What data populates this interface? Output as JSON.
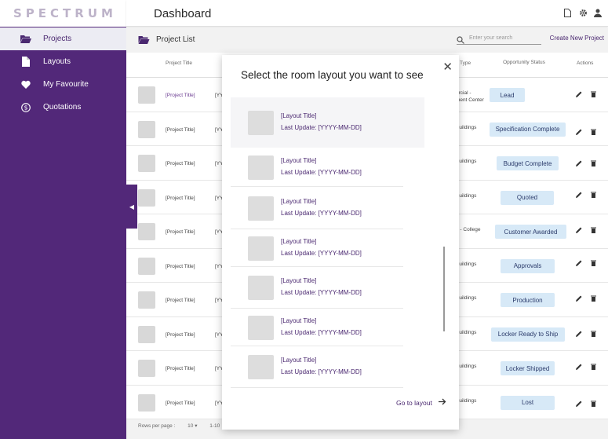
{
  "app": {
    "logo": "SPECTRUM",
    "page_title": "Dashboard"
  },
  "sidebar": {
    "items": [
      {
        "label": "Projects",
        "icon": "folder-icon",
        "active": true
      },
      {
        "label": "Layouts",
        "icon": "file-icon",
        "active": false
      },
      {
        "label": "My Favourite",
        "icon": "heart-icon",
        "active": false
      },
      {
        "label": "Quotations",
        "icon": "dollar-icon",
        "active": false
      }
    ]
  },
  "list": {
    "title": "Project List",
    "search_placeholder": "Enter your search",
    "new_project": "Create New Project",
    "headers": {
      "title": "Project Title",
      "type": "Type",
      "status": "Opportunity Status",
      "actions": "Actions"
    },
    "rows": [
      {
        "title": "[Project Title]",
        "yy": "[YY",
        "type": "ercial -\nment Center",
        "status": "Lead"
      },
      {
        "title": "[Project Title]",
        "yy": "[YY",
        "type": "Buildings",
        "status": "Specification Complete"
      },
      {
        "title": "[Project Title]",
        "yy": "[YY",
        "type": "Buildings",
        "status": "Budget Complete"
      },
      {
        "title": "[Project Title]",
        "yy": "[YY",
        "type": "Buildings",
        "status": "Quoted"
      },
      {
        "title": "[Project Title]",
        "yy": "[YY",
        "type": "n - College",
        "status": "Customer Awarded"
      },
      {
        "title": "[Project Title]",
        "yy": "[YY",
        "type": "Buildings",
        "status": "Approvals"
      },
      {
        "title": "[Project Title]",
        "yy": "[YY",
        "type": "Buildings",
        "status": "Production"
      },
      {
        "title": "[Project Title]",
        "yy": "[YY",
        "type": "Buildings",
        "status": "Locker Ready to Ship"
      },
      {
        "title": "[Project Title]",
        "yy": "[YY",
        "type": "Buildings",
        "status": "Locker Shipped"
      },
      {
        "title": "[Project Title]",
        "yy": "[YY",
        "type": "Buildings",
        "status": "Lost"
      }
    ],
    "pager": {
      "label": "Rows per page :",
      "value": "10",
      "range": "1-10"
    }
  },
  "modal": {
    "title": "Select the room layout you want to see",
    "items": [
      {
        "title": "[Layout Title]",
        "date": "Last Update: [YYYY-MM-DD]"
      },
      {
        "title": "[Layout Title]",
        "date": "Last Update: [YYYY-MM-DD]"
      },
      {
        "title": "[Layout Title]",
        "date": "Last Update: [YYYY-MM-DD]"
      },
      {
        "title": "[Layout Title]",
        "date": "Last Update: [YYYY-MM-DD]"
      },
      {
        "title": "[Layout Title]",
        "date": "Last Update: [YYYY-MM-DD]"
      },
      {
        "title": "[Layout Title]",
        "date": "Last Update: [YYYY-MM-DD]"
      },
      {
        "title": "[Layout Title]",
        "date": "Last Update: [YYYY-MM-DD]"
      }
    ],
    "goto": "Go to layout"
  }
}
